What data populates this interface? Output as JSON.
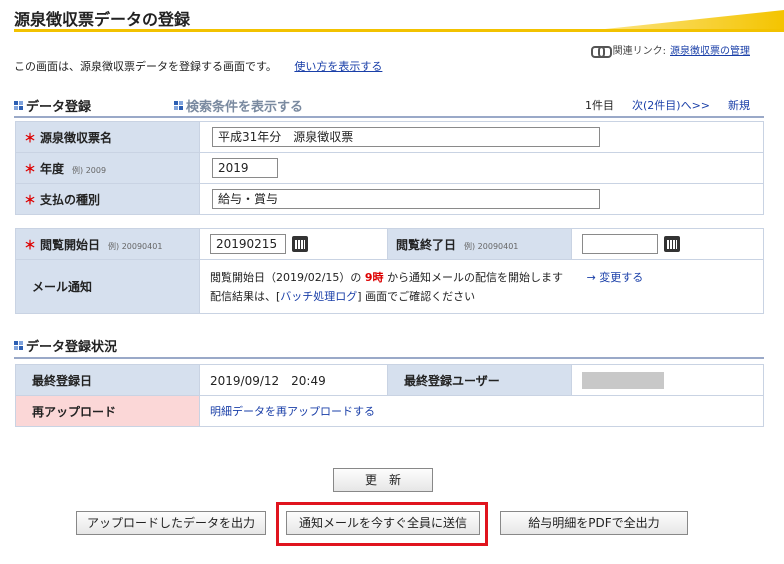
{
  "page": {
    "title": "源泉徴収票データの登録",
    "related_label": "関連リンク:",
    "related_link": "源泉徴収票の管理",
    "description": "この画面は、源泉徴収票データを登録する画面です。",
    "howto_link": "使い方を表示する"
  },
  "data_section": {
    "heading": "データ登録",
    "search_toggle": "検索条件を表示する",
    "pager_count": "1件目",
    "pager_next": "次(2件目)へ>>",
    "pager_new": "新規"
  },
  "form": {
    "req_mark": "＊",
    "name_label": "源泉徴収票名",
    "name_value": "平成31年分　源泉徴収票",
    "year_label": "年度",
    "year_example": "例) 2009",
    "year_value": "2019",
    "payment_label": "支払の種別",
    "payment_value": "給与・賞与",
    "view_start_label": "閲覧開始日",
    "view_start_example": "例) 20090401",
    "view_start_value": "20190215",
    "view_end_label": "閲覧終了日",
    "view_end_example": "例) 20090401",
    "view_end_value": "",
    "mail_label": "メール通知",
    "mail_line1_pre": "閲覧開始日（2019/02/15）の",
    "mail_hour": "9時",
    "mail_line1_post": "から通知メールの配信を開始します",
    "mail_change": "→ 変更する",
    "mail_line2_pre": "配信結果は、[",
    "mail_batch_link": "バッチ処理ログ",
    "mail_line2_post": "] 画面でご確認ください"
  },
  "status_section": {
    "heading": "データ登録状況",
    "last_date_label": "最終登録日",
    "last_date_value": "2019/09/12　20:49",
    "last_user_label": "最終登録ユーザー",
    "reupload_label": "再アップロード",
    "reupload_link": "明細データを再アップロードする"
  },
  "buttons": {
    "update": "更　新",
    "export_uploaded": "アップロードしたデータを出力",
    "send_now": "通知メールを今すぐ全員に送信",
    "pdf_export": "給与明細をPDFで全出力"
  },
  "colors": {
    "accent_yellow": "#f2c200",
    "label_bg": "#d6e0ee",
    "highlight_red": "#e0141e"
  }
}
